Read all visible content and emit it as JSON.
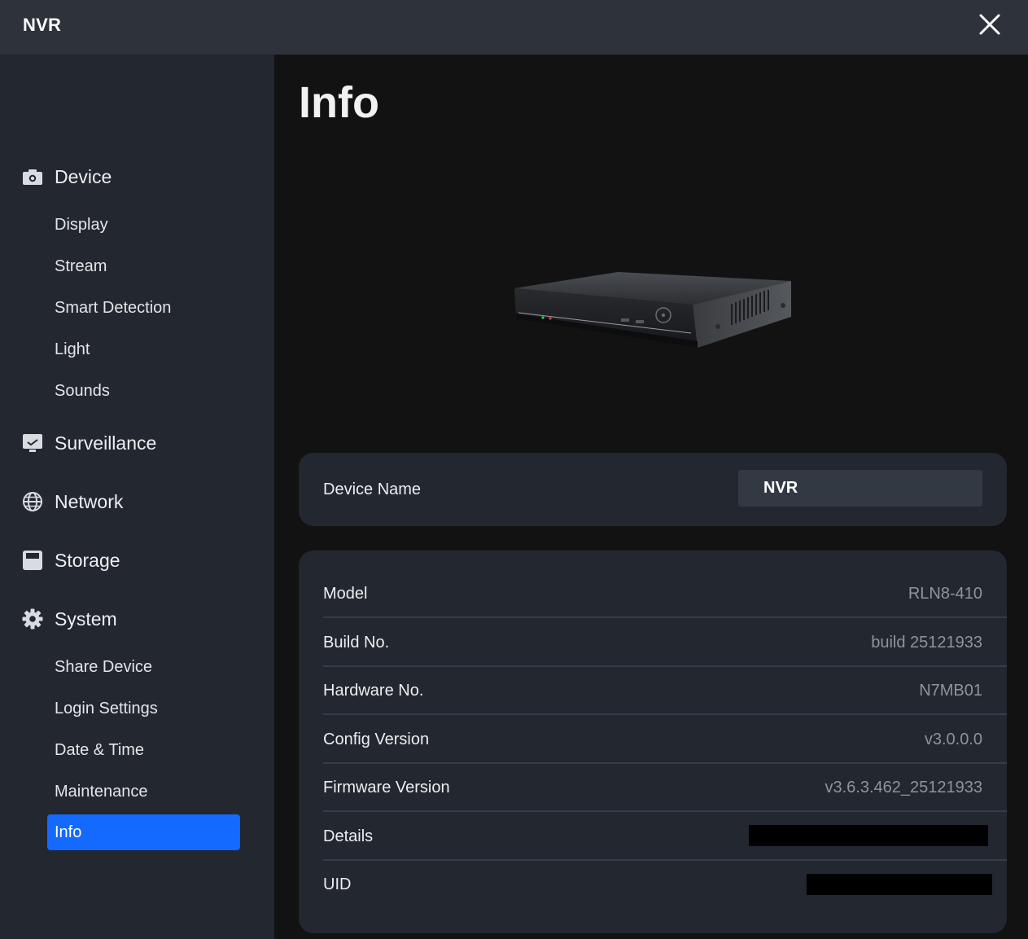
{
  "titlebar": {
    "app_title": "NVR",
    "close_icon": "close-icon"
  },
  "sidebar": {
    "sections": [
      {
        "label": "Device",
        "icon": "camera-icon",
        "items": [
          "Display",
          "Stream",
          "Smart Detection",
          "Light",
          "Sounds"
        ]
      },
      {
        "label": "Surveillance",
        "icon": "monitor-icon",
        "items": []
      },
      {
        "label": "Network",
        "icon": "globe-icon",
        "items": []
      },
      {
        "label": "Storage",
        "icon": "storage-icon",
        "items": []
      },
      {
        "label": "System",
        "icon": "gear-icon",
        "items": [
          "Share Device",
          "Login Settings",
          "Date & Time",
          "Maintenance",
          "Info"
        ]
      }
    ],
    "active_item": "Info"
  },
  "main": {
    "title": "Info",
    "device_image": "nvr-device-image",
    "device_name": {
      "label": "Device Name",
      "value": "NVR"
    },
    "info_rows": [
      {
        "label": "Model",
        "value": "RLN8-410"
      },
      {
        "label": "Build No.",
        "value": "build 25121933"
      },
      {
        "label": "Hardware No.",
        "value": "N7MB01"
      },
      {
        "label": "Config Version",
        "value": "v3.0.0.0"
      },
      {
        "label": "Firmware Version",
        "value": "v3.6.3.462_25121933"
      },
      {
        "label": "Details",
        "value": ""
      },
      {
        "label": "UID",
        "value": ""
      }
    ]
  },
  "colors": {
    "accent": "#1469ff",
    "sidebar_bg": "#23272f",
    "titlebar_bg": "#2d323b",
    "main_bg": "#121212",
    "value_text": "#8f949c"
  }
}
